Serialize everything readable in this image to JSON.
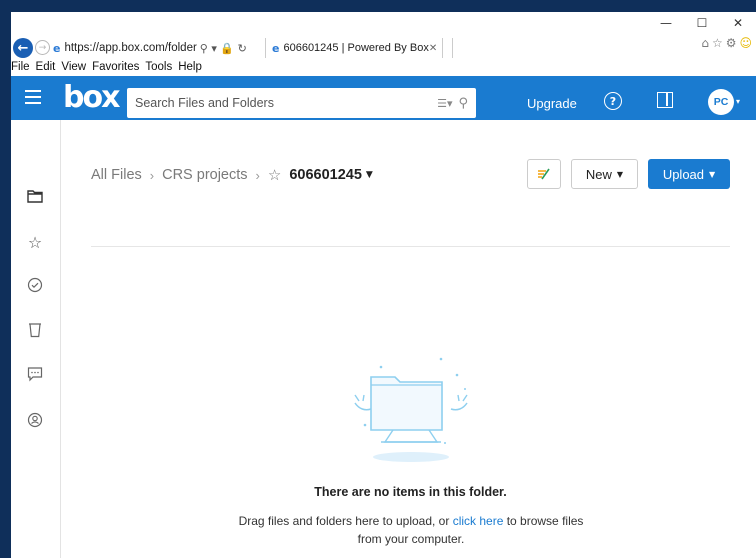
{
  "browser": {
    "url": "https://app.box.com/folder",
    "tab_title": "606601245 | Powered By Box",
    "menu": [
      "File",
      "Edit",
      "View",
      "Favorites",
      "Tools",
      "Help"
    ]
  },
  "header": {
    "search_placeholder": "Search Files and Folders",
    "upgrade_label": "Upgrade",
    "avatar_initials": "PC",
    "brand_color": "#1a7bd0"
  },
  "sidebar": {
    "icons": [
      "folder-icon",
      "star-icon",
      "check-circle-icon",
      "trash-icon",
      "comment-icon",
      "user-circle-icon"
    ]
  },
  "breadcrumb": {
    "root": "All Files",
    "parent": "CRS projects",
    "current": "606601245"
  },
  "toolbar": {
    "new_label": "New",
    "upload_label": "Upload"
  },
  "empty_state": {
    "title": "There are no items in this folder.",
    "desc_before": "Drag files and folders here to upload, or ",
    "desc_link": "click here",
    "desc_after": " to browse files from your computer."
  }
}
